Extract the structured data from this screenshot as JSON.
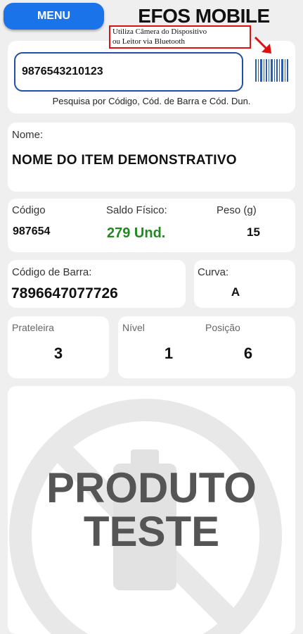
{
  "header": {
    "menu_label": "MENU",
    "app_title": "EFOS MOBILE"
  },
  "search": {
    "value": "9876543210123",
    "hint": "Pesquisa por Código, Cód. de Barra e Cód. Dun.",
    "tooltip_line1": "Utiliza Câmera do Dispositivo",
    "tooltip_line2": "ou Leitor via Bluetooth",
    "scanner_icon": "barcode-icon"
  },
  "item": {
    "name_label": "Nome:",
    "name_value": "NOME DO ITEM DEMONSTRATIVO",
    "codigo_label": "Código",
    "codigo_value": "987654",
    "saldo_label": "Saldo Físico:",
    "saldo_value": "279 Und.",
    "peso_label": "Peso (g)",
    "peso_value": "15",
    "barra_label": "Código de Barra:",
    "barra_value": "7896647077726",
    "curva_label": "Curva:",
    "curva_value": "A",
    "prateleira_label": "Prateleira",
    "prateleira_value": "3",
    "nivel_label": "Nível",
    "nivel_value": "1",
    "posicao_label": "Posição",
    "posicao_value": "6"
  },
  "image": {
    "line1": "PRODUTO",
    "line2": "TESTE"
  },
  "colors": {
    "menu": "#1a73e8",
    "saldo": "#1f8a1f",
    "input_border": "#1f4fa8",
    "tooltip_border": "#dd1111"
  }
}
